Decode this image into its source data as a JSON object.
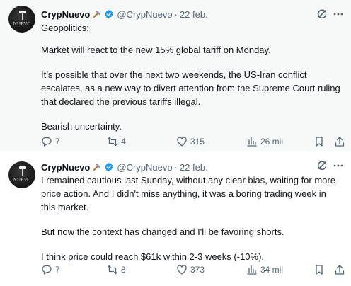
{
  "tweets": [
    {
      "author": {
        "name": "CrypNuevo",
        "handle": "@CrypNuevo",
        "avatar_text": "NUEVO"
      },
      "separator": "·",
      "date": "22 feb.",
      "paragraphs": [
        "Geopolitics:",
        "Market will react to the new 15% global tariff on Monday.",
        "It’s possible that over the next two weekends, the US-Iran conflict escalates, as a new way to divert attention from the Supreme Court ruling that declared the previous tariffs illegal.",
        "Bearish uncertainty."
      ],
      "stats": {
        "replies": "7",
        "reposts": "4",
        "likes": "315",
        "views": "26 mil"
      }
    },
    {
      "author": {
        "name": "CrypNuevo",
        "handle": "@CrypNuevo",
        "avatar_text": "NUEVO"
      },
      "separator": "·",
      "date": "22 feb.",
      "paragraphs": [
        "I remained cautious last Sunday, without any clear bias, waiting for more price action. And I didn't miss anything, it was a boring trading week in this market.",
        "But now the context has changed and I'll be favoring shorts.",
        "I think price could reach $61k within 2-3 weeks (-10%)."
      ],
      "stats": {
        "replies": "7",
        "reposts": "8",
        "likes": "373",
        "views": "34 mil"
      }
    }
  ],
  "icons": {
    "verified": "verified-badge-icon",
    "hammer": "hammer-emoji-icon",
    "grok": "grok-icon",
    "more": "more-icon",
    "reply": "reply-icon",
    "repost": "repost-icon",
    "like": "like-icon",
    "views": "views-icon",
    "bookmark": "bookmark-icon",
    "share": "share-icon"
  },
  "colors": {
    "verified": "#1d9bf0",
    "text": "#0f1419",
    "secondary": "#536471",
    "hover_bg": "#f7f9f9"
  }
}
